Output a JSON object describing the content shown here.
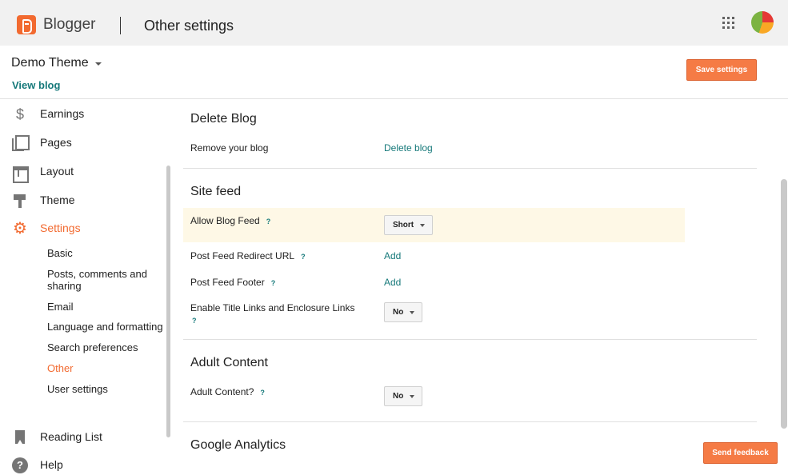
{
  "header": {
    "brand": "Blogger",
    "page_title": "Other settings",
    "apps_icon": "apps-grid-icon",
    "avatar_icon": "account-avatar"
  },
  "blog": {
    "name": "Demo Theme",
    "view_blog": "View blog",
    "save_settings": "Save settings"
  },
  "sidebar": {
    "items": [
      {
        "label": "Earnings",
        "icon": "dollar-icon"
      },
      {
        "label": "Pages",
        "icon": "pages-icon"
      },
      {
        "label": "Layout",
        "icon": "layout-icon"
      },
      {
        "label": "Theme",
        "icon": "paint-roller-icon"
      },
      {
        "label": "Settings",
        "icon": "gear-icon"
      }
    ],
    "settings_sub": [
      "Basic",
      "Posts, comments and sharing",
      "Email",
      "Language and formatting",
      "Search preferences",
      "Other",
      "User settings"
    ],
    "reading_list": "Reading List",
    "help": "Help"
  },
  "main": {
    "delete_blog": {
      "title": "Delete Blog",
      "remove_label": "Remove your blog",
      "delete_link": "Delete blog"
    },
    "site_feed": {
      "title": "Site feed",
      "allow_feed_label": "Allow Blog Feed",
      "allow_feed_value": "Short",
      "redirect_label": "Post Feed Redirect URL",
      "redirect_link": "Add",
      "footer_label": "Post Feed Footer",
      "footer_link": "Add",
      "title_links_label": "Enable Title Links and Enclosure Links",
      "title_links_value": "No"
    },
    "adult_content": {
      "title": "Adult Content",
      "label": "Adult Content?",
      "value": "No"
    },
    "google_analytics": {
      "title": "Google Analytics"
    },
    "help_glyph": "?"
  },
  "feedback": "Send feedback",
  "colors": {
    "accent": "#f26a30",
    "link": "#16797a",
    "highlight": "#fef8e6"
  }
}
